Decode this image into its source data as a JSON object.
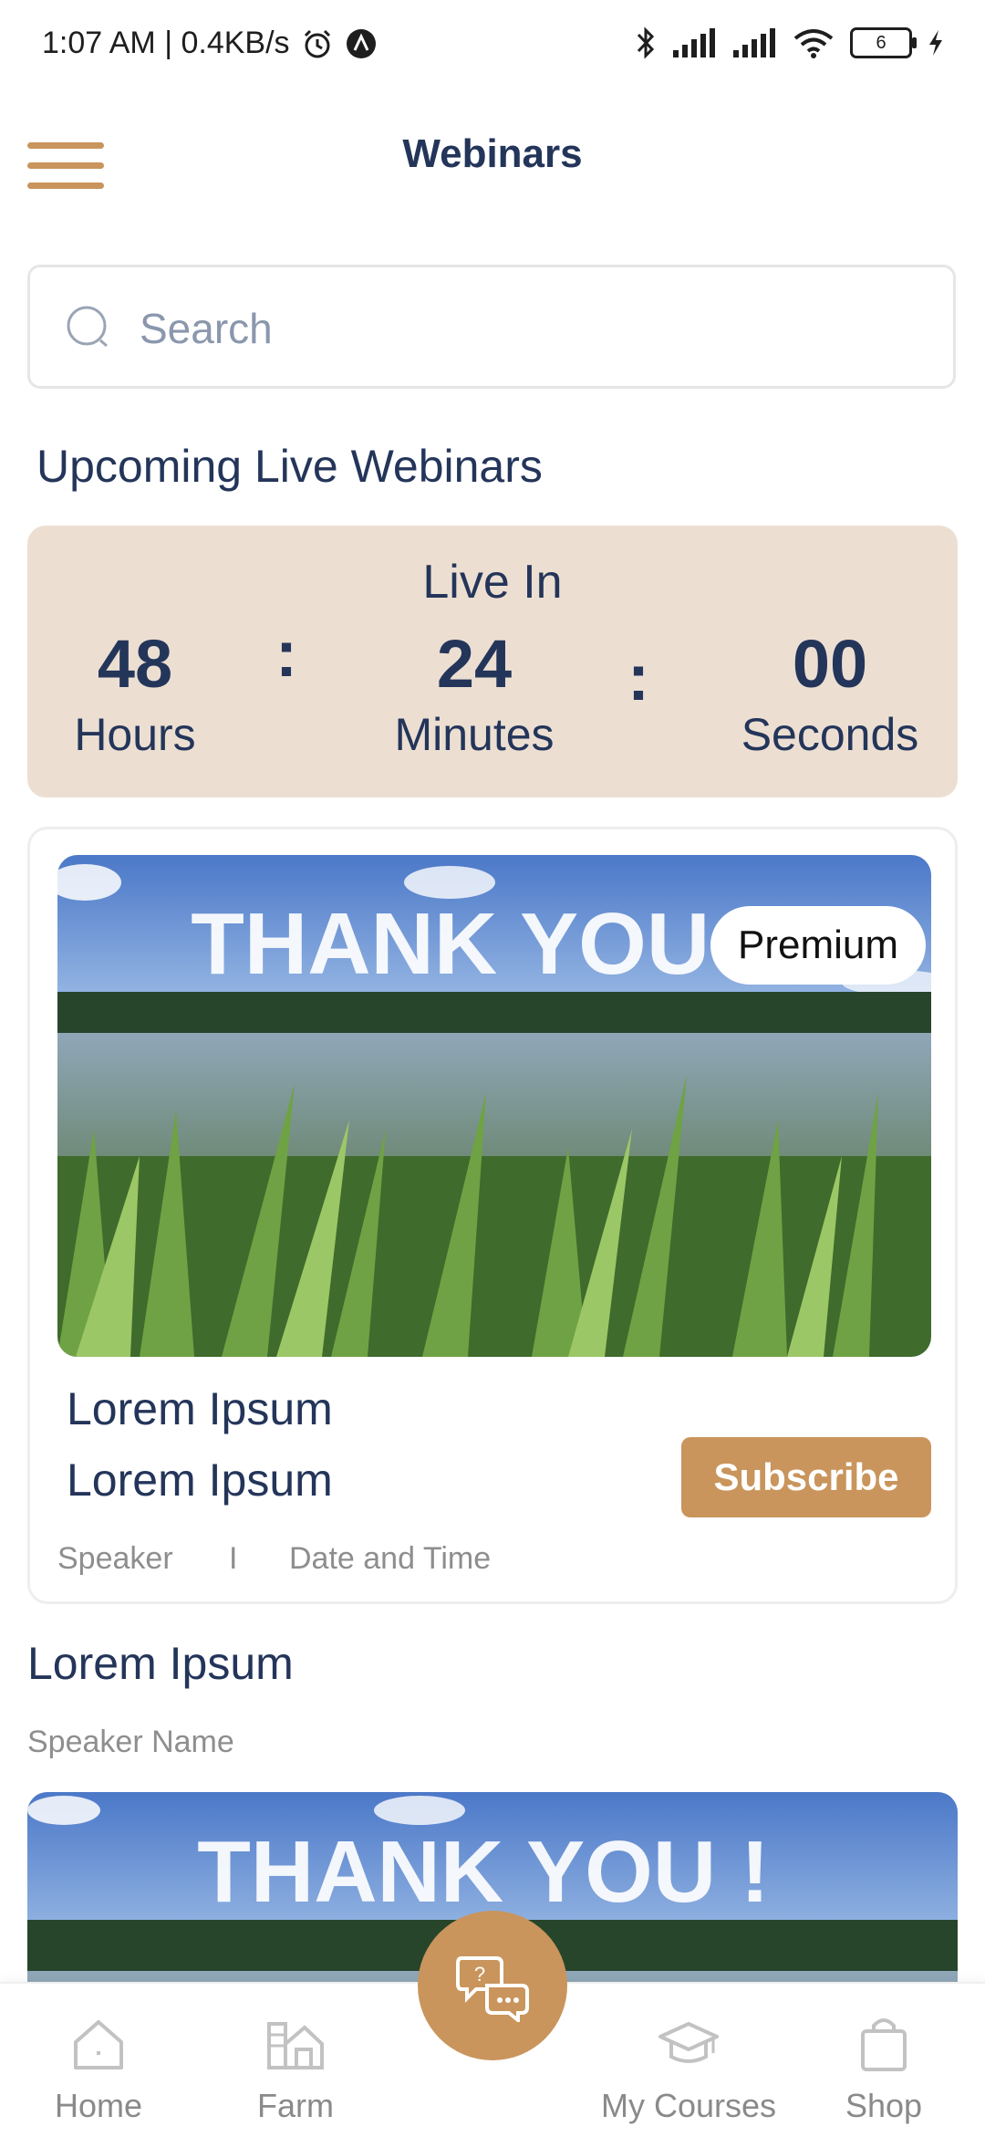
{
  "status_bar": {
    "time_speed": "1:07 AM | 0.4KB/s",
    "battery_level": "6"
  },
  "header": {
    "title": "Webinars"
  },
  "search": {
    "placeholder": "Search"
  },
  "upcoming": {
    "section_title": "Upcoming Live Webinars",
    "live_in_label": "Live In",
    "hours_value": "48",
    "hours_label": "Hours",
    "minutes_value": "24",
    "minutes_label": "Minutes",
    "seconds_value": "00",
    "seconds_label": "Seconds",
    "separator": ":"
  },
  "webinar_card": {
    "badge": "Premium",
    "title_line1": "Lorem Ipsum",
    "title_line2": "Lorem Ipsum",
    "subscribe_label": "Subscribe",
    "speaker_label": "Speaker",
    "meta_divider": "I",
    "date_time_label": "Date and Time",
    "image_text": "THANK YOU !"
  },
  "second_item": {
    "title": "Lorem Ipsum",
    "speaker_name": "Speaker Name",
    "image_text": "THANK YOU !"
  },
  "bottom_nav": {
    "items": [
      {
        "label": "Home",
        "icon": "home-icon"
      },
      {
        "label": "Farm",
        "icon": "farm-icon"
      },
      {
        "label": "My Courses",
        "icon": "graduation-cap-icon"
      },
      {
        "label": "Shop",
        "icon": "shopping-bag-icon"
      }
    ],
    "fab_icon": "chat-help-icon"
  },
  "colors": {
    "accent": "#c9955c",
    "heading": "#24355a",
    "countdown_bg": "#ecdfd2",
    "muted": "#8e8e8e"
  }
}
